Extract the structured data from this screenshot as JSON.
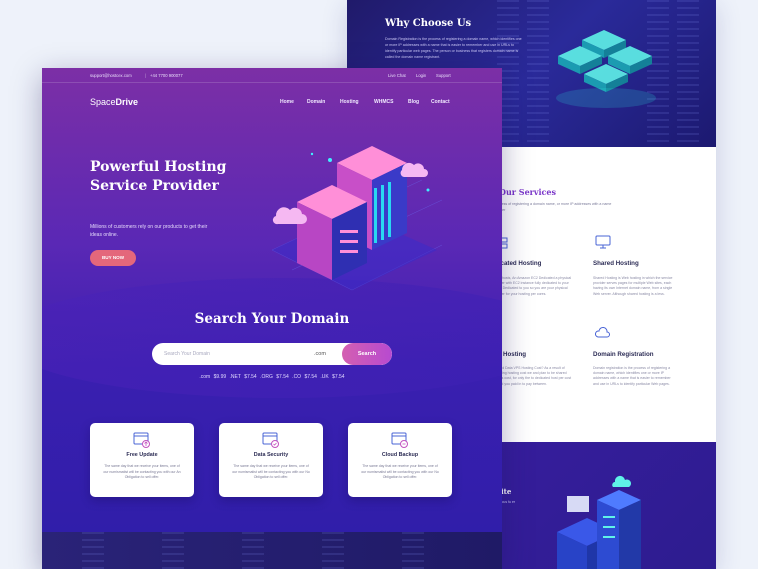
{
  "back": {
    "why_title": "Why Choose Us",
    "why_text": "Domain Registration is the process of registering a domain name, which identifies one or more IP addresses with a name that is easier to remember and use in URLs to identify particular web pages. The person or business that registers domain name is called the domain name registrant.",
    "services_title": "Our Services",
    "services_sub": "is the process of registering a domain name, or more IP addresses with a name that is easier",
    "services": [
      {
        "title": "dicated Hosting",
        "text": "Fed hosts, An Amazon EC2 Dedicated a physical server with EC2 instance fully dedicated to your use. Dedicated to you so you are your physical server for your hosting per cores."
      },
      {
        "title": "Shared Hosting",
        "text": "Shared Hosting is Web hosting in which the service provider serves pages for multiple Web sites, each having its own Internet domain name, from a single Web server. Although shared hosting is a less."
      },
      {
        "title": "Hosting",
        "text": "Cloud Data VPS Hosting Cost? As a result of running hosting cost we and plan to be shared hosts cost, for only the to dedicated host per cost cloud you paid in to pay between."
      },
      {
        "title": "Domain Registration",
        "text": "Domain registration is the process of registering a domain name, which identifies one or more IP addresses with a name that is easier to remember and use in URLs to identify particular Web pages."
      }
    ],
    "site_title": "site",
    "site_sub": "ite cus fu er"
  },
  "front": {
    "email": "support@hostcex.com",
    "phone": "+44 7700 900077",
    "top_links": [
      "Live Chat",
      "Login",
      "Support"
    ],
    "logo_light": "Space",
    "logo_bold": "Drive",
    "nav": [
      "Home",
      "Domain",
      "Hosting",
      "WHMCS",
      "Blog",
      "Contact"
    ],
    "hero_title": "Powerful Hosting Service Provider",
    "hero_sub": "Millions of customers rely on our products to get their ideas online.",
    "buy_label": "BUY NOW",
    "search_title": "Search Your Domain",
    "search_placeholder": "Search Your Domain",
    "search_ext": ".com",
    "search_button": "Search",
    "prices": ".com $9.99 .NET $7.54 .ORG $7.54 .CO $7.54 .UK $7.54",
    "cards": [
      {
        "title": "Free Update",
        "text": "The same day that we receive your items, one of our numismatist will be contacting you with our An Obligation to sell offer."
      },
      {
        "title": "Data Security",
        "text": "The same day that we receive your items, one of our numismatist will be contacting you with our No Obligation to sell offer."
      },
      {
        "title": "Cloud Backup",
        "text": "The same day that we receive your items, one of our numismatist will be contacting you with our No Obligation to sell offer."
      }
    ]
  },
  "colors": {
    "accent_pink": "#e4677b",
    "search_button": "#c453c0",
    "services_purple": "#7a36c9",
    "hero_gradient_top": "#7c2fa6",
    "hero_gradient_bottom": "#2e1ea8"
  }
}
